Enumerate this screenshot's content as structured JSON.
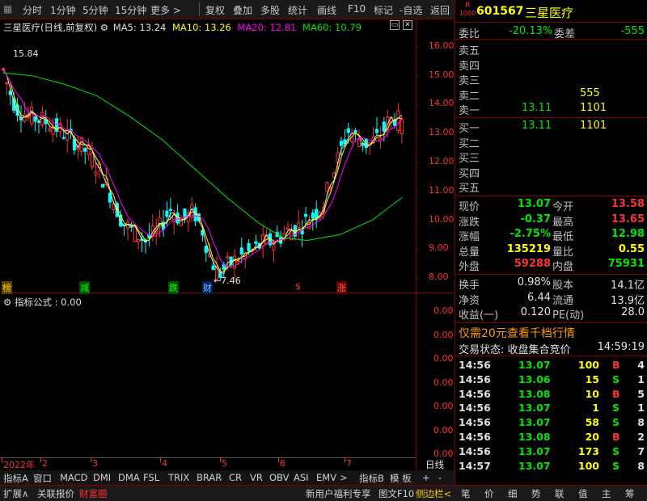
{
  "toolbar": {
    "items": [
      "分时",
      "1分钟",
      "5分钟",
      "15分钟",
      "更多 >",
      "复权",
      "叠加",
      "多股",
      "统计",
      "画线",
      "F10",
      "标记",
      "-自选",
      "返回"
    ]
  },
  "chart_header": {
    "name": "三星医疗",
    "mode": "(日线,前复权)",
    "ma5": "MA5: 13.24",
    "ma10": "MA10: 13.26",
    "ma20": "MA20: 12.81",
    "ma60": "MA60: 10.79"
  },
  "chart_data": {
    "type": "candlestick",
    "ylim": [
      7.5,
      16.5
    ],
    "yticks": [
      "16.00",
      "15.00",
      "14.00",
      "13.00",
      "12.00",
      "11.00",
      "10.00",
      "9.00",
      "8.00"
    ],
    "annotations": {
      "high": "15.84",
      "low": "←7.46"
    },
    "month_labels": [
      "2022年",
      "2",
      "3",
      "4",
      "5",
      "6",
      "7"
    ],
    "event_markers": [
      "榜",
      "减",
      "跌",
      "财",
      "$",
      "涨"
    ],
    "series": [
      {
        "name": "MA5",
        "color": "#e0e0e0"
      },
      {
        "name": "MA10",
        "color": "#ffff00"
      },
      {
        "name": "MA20",
        "color": "#ff00ff"
      },
      {
        "name": "MA60",
        "color": "#00e600"
      }
    ]
  },
  "indicator": {
    "title": "指标公式 : 0.00",
    "yticks": [
      "0.00",
      "0.00",
      "0.00",
      "0.00",
      "0.00",
      "0.00",
      "0.00",
      "0.00"
    ]
  },
  "stock": {
    "code": "601567",
    "name": "三星医疗",
    "badge_r": "R",
    "badge_num": "1000"
  },
  "weibi": {
    "label": "委比",
    "value": "-20.13%",
    "label2": "委差",
    "value2": "-555"
  },
  "sell": [
    {
      "label": "卖五",
      "price": "",
      "vol": ""
    },
    {
      "label": "卖四",
      "price": "",
      "vol": ""
    },
    {
      "label": "卖三",
      "price": "",
      "vol": ""
    },
    {
      "label": "卖二",
      "price": "",
      "vol": "555"
    },
    {
      "label": "卖一",
      "price": "13.11",
      "vol": "1101"
    }
  ],
  "buy": [
    {
      "label": "买一",
      "price": "13.11",
      "vol": "1101"
    },
    {
      "label": "买二",
      "price": "",
      "vol": ""
    },
    {
      "label": "买三",
      "price": "",
      "vol": ""
    },
    {
      "label": "买四",
      "price": "",
      "vol": ""
    },
    {
      "label": "买五",
      "price": "",
      "vol": ""
    }
  ],
  "quote": [
    {
      "l1": "现价",
      "v1": "13.07",
      "l2": "今开",
      "v2": "13.58"
    },
    {
      "l1": "涨跌",
      "v1": "-0.37",
      "l2": "最高",
      "v2": "13.65"
    },
    {
      "l1": "涨幅",
      "v1": "-2.75%",
      "l2": "最低",
      "v2": "12.98"
    },
    {
      "l1": "总量",
      "v1": "135219",
      "l2": "量比",
      "v2": "0.55"
    },
    {
      "l1": "外盘",
      "v1": "59288",
      "l2": "内盘",
      "v2": "75931"
    }
  ],
  "fin": [
    {
      "l1": "换手",
      "v1": "0.98%",
      "l2": "股本",
      "v2": "14.1亿"
    },
    {
      "l1": "净资",
      "v1": "6.44",
      "l2": "流通",
      "v2": "13.9亿"
    },
    {
      "l1": "收益(一)",
      "v1": "0.120",
      "l2": "PE(动)",
      "v2": "28.0"
    }
  ],
  "promo": "仅需20元查看千档行情",
  "status": {
    "label": "交易状态: 收盘集合竞价",
    "time": "14:59:19"
  },
  "ticks": [
    {
      "time": "14:56",
      "price": "13.07",
      "vol": "100",
      "side": "B",
      "n": "4"
    },
    {
      "time": "14:56",
      "price": "13.06",
      "vol": "15",
      "side": "S",
      "n": "1"
    },
    {
      "time": "14:56",
      "price": "13.08",
      "vol": "10",
      "side": "B",
      "n": "5"
    },
    {
      "time": "14:56",
      "price": "13.07",
      "vol": "1",
      "side": "S",
      "n": "1"
    },
    {
      "time": "14:56",
      "price": "13.07",
      "vol": "58",
      "side": "S",
      "n": "8"
    },
    {
      "time": "14:56",
      "price": "13.08",
      "vol": "20",
      "side": "B",
      "n": "2"
    },
    {
      "time": "14:56",
      "price": "13.07",
      "vol": "173",
      "side": "S",
      "n": "7"
    },
    {
      "time": "14:57",
      "price": "13.07",
      "vol": "100",
      "side": "S",
      "n": "8"
    }
  ],
  "tabs": [
    "指标A",
    "窗口",
    "MACD",
    "DMI",
    "DMA",
    "FSL",
    "TRIX",
    "BRAR",
    "CR",
    "VR",
    "OBV",
    "ASI",
    "EMV",
    ">",
    "指标B",
    "模 板",
    "+",
    "-",
    "日线"
  ],
  "bottom_left": [
    "扩展∧",
    "关联报价",
    "财富圈"
  ],
  "bottom_mid": [
    "新用户福利专享",
    "图文F10",
    "侧边栏<"
  ],
  "bottom_right": [
    "笔",
    "价",
    "细",
    "势",
    "联",
    "值",
    "主",
    "筹"
  ]
}
